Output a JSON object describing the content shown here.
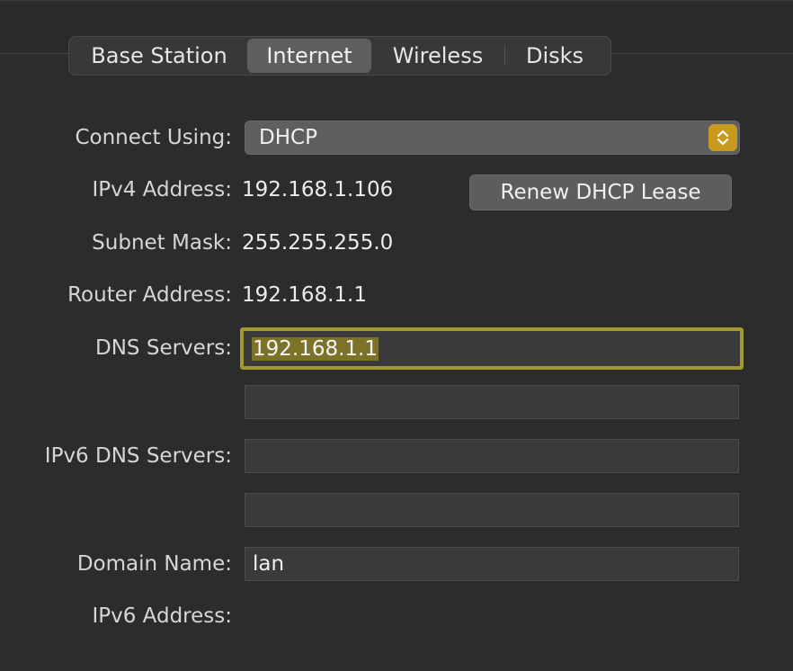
{
  "tabs": [
    {
      "label": "Base Station",
      "active": false
    },
    {
      "label": "Internet",
      "active": true
    },
    {
      "label": "Wireless",
      "active": false
    },
    {
      "label": "Disks",
      "active": false
    }
  ],
  "form": {
    "connect_using": {
      "label": "Connect Using:",
      "value": "DHCP"
    },
    "ipv4_address": {
      "label": "IPv4 Address:",
      "value": "192.168.1.106"
    },
    "renew_button": "Renew DHCP Lease",
    "subnet_mask": {
      "label": "Subnet Mask:",
      "value": "255.255.255.0"
    },
    "router_address": {
      "label": "Router Address:",
      "value": "192.168.1.1"
    },
    "dns_servers": {
      "label": "DNS Servers:",
      "values": [
        "192.168.1.1",
        ""
      ]
    },
    "ipv6_dns_servers": {
      "label": "IPv6 DNS Servers:",
      "values": [
        "",
        ""
      ]
    },
    "domain_name": {
      "label": "Domain Name:",
      "value": "lan"
    },
    "ipv6_address": {
      "label": "IPv6 Address:",
      "value": ""
    }
  },
  "colors": {
    "focus_ring": "#a09a2c",
    "select_accent": "#c79a1b",
    "text_selection": "#7c7328"
  },
  "icons": {
    "select_arrows": "chevron-up-down-icon"
  }
}
